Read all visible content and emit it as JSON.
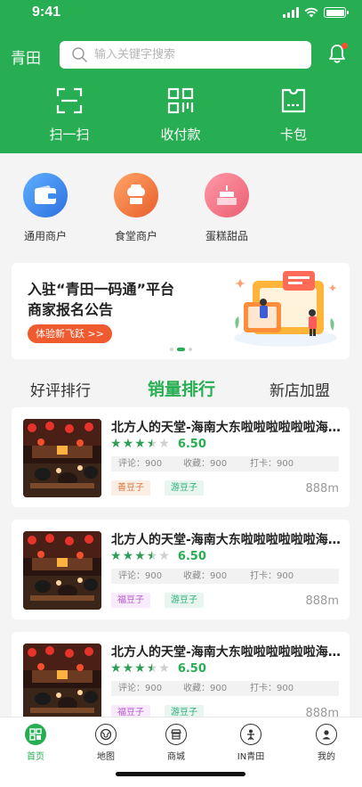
{
  "status_bar": {
    "time": "9:41"
  },
  "header": {
    "city": "青田",
    "search": {
      "placeholder": "输入关键字搜索"
    },
    "colors": {
      "brand": "#27ae52",
      "notification_dot": "#ff4d30"
    },
    "quick_actions": [
      {
        "label": "扫一扫",
        "icon": "scan-icon"
      },
      {
        "label": "收付款",
        "icon": "qr-payment-icon"
      },
      {
        "label": "卡包",
        "icon": "card-wallet-icon"
      }
    ]
  },
  "categories": [
    {
      "label": "通用商户",
      "icon": "wallet-icon",
      "color": "#3b8df0"
    },
    {
      "label": "食堂商户",
      "icon": "chef-hat-icon",
      "color": "#f0803b"
    },
    {
      "label": "蛋糕甜品",
      "icon": "cake-icon",
      "color": "#f07585"
    }
  ],
  "banner": {
    "title_line1": "入驻“青田一码通”平台",
    "title_line2": "商家报名公告",
    "button": "体验新飞跃 >>",
    "active_slide": 2,
    "slide_count": 3
  },
  "ranking_tabs": [
    {
      "label": "好评排行",
      "active": false
    },
    {
      "label": "销量排行",
      "active": true
    },
    {
      "label": "新店加盟",
      "active": false
    }
  ],
  "merchants": [
    {
      "name": "北方人的天堂-海南大东啦啦啦啦啦啦海南大东",
      "rating": 3.5,
      "score": "6.50",
      "reviews": "评论：900",
      "favorites": "收藏：900",
      "checkins": "打卡：900",
      "tags": [
        "善豆子",
        "游豆子"
      ],
      "distance": "888m"
    },
    {
      "name": "北方人的天堂-海南大东啦啦啦啦啦啦海南大东",
      "rating": 3.5,
      "score": "6.50",
      "reviews": "评论：900",
      "favorites": "收藏：900",
      "checkins": "打卡：900",
      "tags": [
        "福豆子",
        "游豆子"
      ],
      "distance": "888m"
    },
    {
      "name": "北方人的天堂-海南大东啦啦啦啦啦啦海南大东",
      "rating": 3.5,
      "score": "6.50",
      "reviews": "评论：900",
      "favorites": "收藏：900",
      "checkins": "打卡：900",
      "tags": [
        "福豆子",
        "游豆子"
      ],
      "distance": "888m"
    }
  ],
  "tab_bar": [
    {
      "label": "首页",
      "icon": "home-qr-icon",
      "active": true
    },
    {
      "label": "地图",
      "icon": "globe-icon",
      "active": false
    },
    {
      "label": "商城",
      "icon": "shop-icon",
      "active": false
    },
    {
      "label": "IN青田",
      "icon": "person-icon",
      "active": false
    },
    {
      "label": "我的",
      "icon": "user-icon",
      "active": false
    }
  ]
}
